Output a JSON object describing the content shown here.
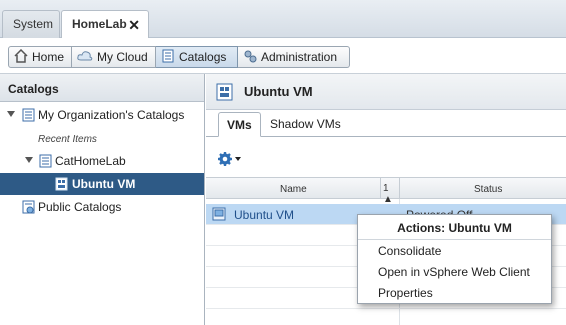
{
  "top_tabs": [
    {
      "label": "System"
    },
    {
      "label": "HomeLab",
      "close": "✕"
    }
  ],
  "nav": {
    "home": "Home",
    "my_cloud": "My Cloud",
    "catalogs": "Catalogs",
    "administration": "Administration"
  },
  "left_panel": {
    "title": "Catalogs",
    "my_org": "My Organization's Catalogs",
    "recent_items": "Recent Items",
    "cat_homelab": "CatHomeLab",
    "ubuntu_vm": "Ubuntu VM",
    "public_catalogs": "Public Catalogs"
  },
  "content": {
    "title": "Ubuntu VM",
    "tabs": [
      {
        "label": "VMs"
      },
      {
        "label": "Shadow VMs"
      }
    ]
  },
  "grid": {
    "col_name": "Name",
    "col_sort": "1 ▲",
    "col_status": "Status",
    "row_name": "Ubuntu VM",
    "row_status": "Powered Off"
  },
  "context_menu": {
    "title": "Actions: Ubuntu VM",
    "items": [
      "Consolidate",
      "Open in vSphere Web Client",
      "Properties"
    ]
  },
  "colors": {
    "selected_tree": "#2e5a86",
    "selected_row": "#bcd8f3",
    "link": "#1f4f8a"
  }
}
